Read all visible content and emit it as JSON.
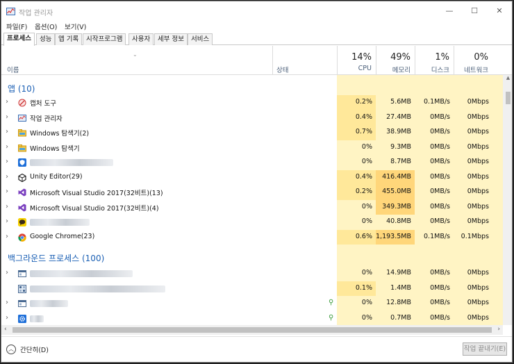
{
  "window": {
    "title": "작업 관리자",
    "min": "—",
    "max": "☐",
    "close": "✕"
  },
  "menu": [
    "파일(F)",
    "옵션(O)",
    "보기(V)"
  ],
  "tabs": [
    "프로세스",
    "성능",
    "앱 기록",
    "시작프로그램",
    "사용자",
    "세부 정보",
    "서비스"
  ],
  "header": {
    "name": "이름",
    "status": "상태",
    "cpu": {
      "pct": "14%",
      "label": "CPU"
    },
    "mem": {
      "pct": "49%",
      "label": "메모리"
    },
    "disk": {
      "pct": "1%",
      "label": "디스크"
    },
    "net": {
      "pct": "0%",
      "label": "네트워크"
    }
  },
  "groups": {
    "apps": "앱 (10)",
    "background": "백그라운드 프로세스 (100)"
  },
  "apps": [
    {
      "name": "캡처 도구",
      "icon": "snipping-tool-icon",
      "cpu": "0.2%",
      "mem": "5.6MB",
      "disk": "0.1MB/s",
      "net": "0Mbps"
    },
    {
      "name": "작업 관리자",
      "icon": "task-manager-icon",
      "cpu": "0.4%",
      "mem": "27.4MB",
      "disk": "0MB/s",
      "net": "0Mbps"
    },
    {
      "name": "Windows 탐색기(2)",
      "icon": "folder-icon",
      "cpu": "0.7%",
      "mem": "38.9MB",
      "disk": "0MB/s",
      "net": "0Mbps"
    },
    {
      "name": "Windows 탐색기",
      "icon": "folder-icon",
      "cpu": "0%",
      "mem": "9.3MB",
      "disk": "0MB/s",
      "net": "0Mbps"
    },
    {
      "name": "",
      "icon": "shield-icon",
      "cpu": "0%",
      "mem": "8.7MB",
      "disk": "0MB/s",
      "net": "0Mbps"
    },
    {
      "name": "Unity Editor(29)",
      "icon": "unity-icon",
      "cpu": "0.4%",
      "mem": "416.4MB",
      "disk": "0MB/s",
      "net": "0Mbps"
    },
    {
      "name": "Microsoft Visual Studio 2017(32비트)(13)",
      "icon": "visual-studio-icon",
      "cpu": "0.2%",
      "mem": "455.0MB",
      "disk": "0MB/s",
      "net": "0Mbps"
    },
    {
      "name": "Microsoft Visual Studio 2017(32비트)(4)",
      "icon": "visual-studio-icon",
      "cpu": "0%",
      "mem": "349.3MB",
      "disk": "0MB/s",
      "net": "0Mbps"
    },
    {
      "name": "",
      "icon": "chat-bubble-icon",
      "cpu": "0%",
      "mem": "40.8MB",
      "disk": "0MB/s",
      "net": "0Mbps"
    },
    {
      "name": "Google Chrome(23)",
      "icon": "chrome-icon",
      "cpu": "0.6%",
      "mem": "1,193.5MB",
      "disk": "0.1MB/s",
      "net": "0.1Mbps"
    }
  ],
  "background": [
    {
      "icon": "window-icon",
      "cpu": "0%",
      "mem": "14.9MB",
      "disk": "0MB/s",
      "net": "0Mbps"
    },
    {
      "icon": "grid-app-icon",
      "cpu": "0.1%",
      "mem": "1.4MB",
      "disk": "0MB/s",
      "net": "0Mbps"
    },
    {
      "icon": "window-icon",
      "cpu": "0%",
      "mem": "12.8MB",
      "disk": "0MB/s",
      "net": "0Mbps"
    },
    {
      "icon": "gear-icon",
      "cpu": "0%",
      "mem": "0.7MB",
      "disk": "0MB/s",
      "net": "0Mbps"
    }
  ],
  "footer": {
    "collapse": "간단히(D)",
    "end_task": "작업 끝내기(E)"
  },
  "colors": {
    "cpu_bg": "#fff4c4",
    "cpu_bg_hi": "#ffe89a",
    "mem_bg": "#fff0b3",
    "mem_bg_hi": "#ffd67a",
    "group": "#1a5fb4"
  }
}
